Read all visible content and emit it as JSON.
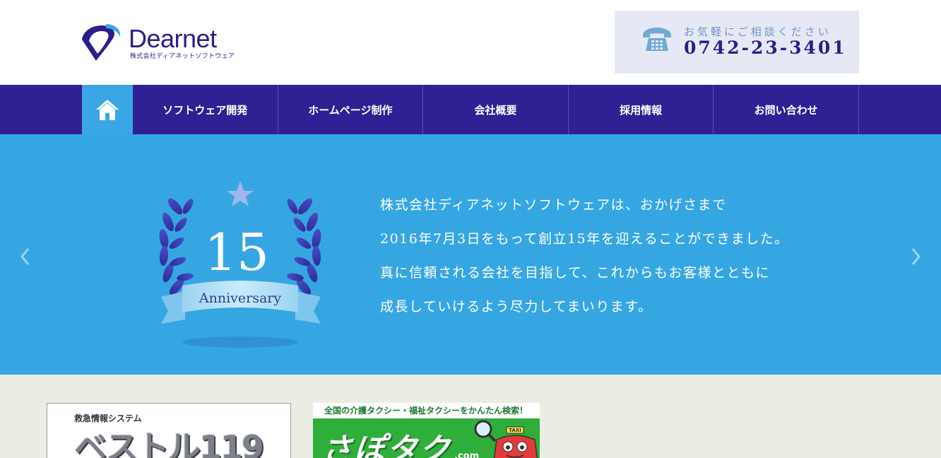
{
  "header": {
    "logo_text": "Dearnet",
    "logo_subtitle": "株式会社ディアネットソフトウェア",
    "contact_label": "お気軽にご相談ください",
    "contact_phone": "0742-23-3401"
  },
  "nav": {
    "home_icon": "home-icon",
    "items": [
      {
        "label": "ソフトウェア開発"
      },
      {
        "label": "ホームページ制作"
      },
      {
        "label": "会社概要"
      },
      {
        "label": "採用情報"
      },
      {
        "label": "お問い合わせ"
      }
    ]
  },
  "hero": {
    "emblem_number": "15",
    "emblem_ribbon": "Anniversary",
    "lines": [
      "株式会社ディアネットソフトウェアは、おかげさまで",
      "2016年7月3日をもって創立15年を迎えることができました。",
      "真に信頼される会社を目指して、これからもお客様とともに",
      "成長していけるよう尽力してまいります。"
    ]
  },
  "banners": {
    "bestoru": {
      "small_text": "救急情報システム",
      "big_text": "ベストル119"
    },
    "sapotaku": {
      "top_text": "全国の介護タクシー・福祉タクシーをかんたん検索！",
      "logo_text": "さぽタク",
      "logo_suffix": ".com",
      "taxi_sign": "TAXI"
    }
  },
  "colors": {
    "brand_navy": "#2f2093",
    "hero_blue": "#36a6e3",
    "home_active": "#3aa6e4",
    "lower_bg": "#eaede1"
  }
}
